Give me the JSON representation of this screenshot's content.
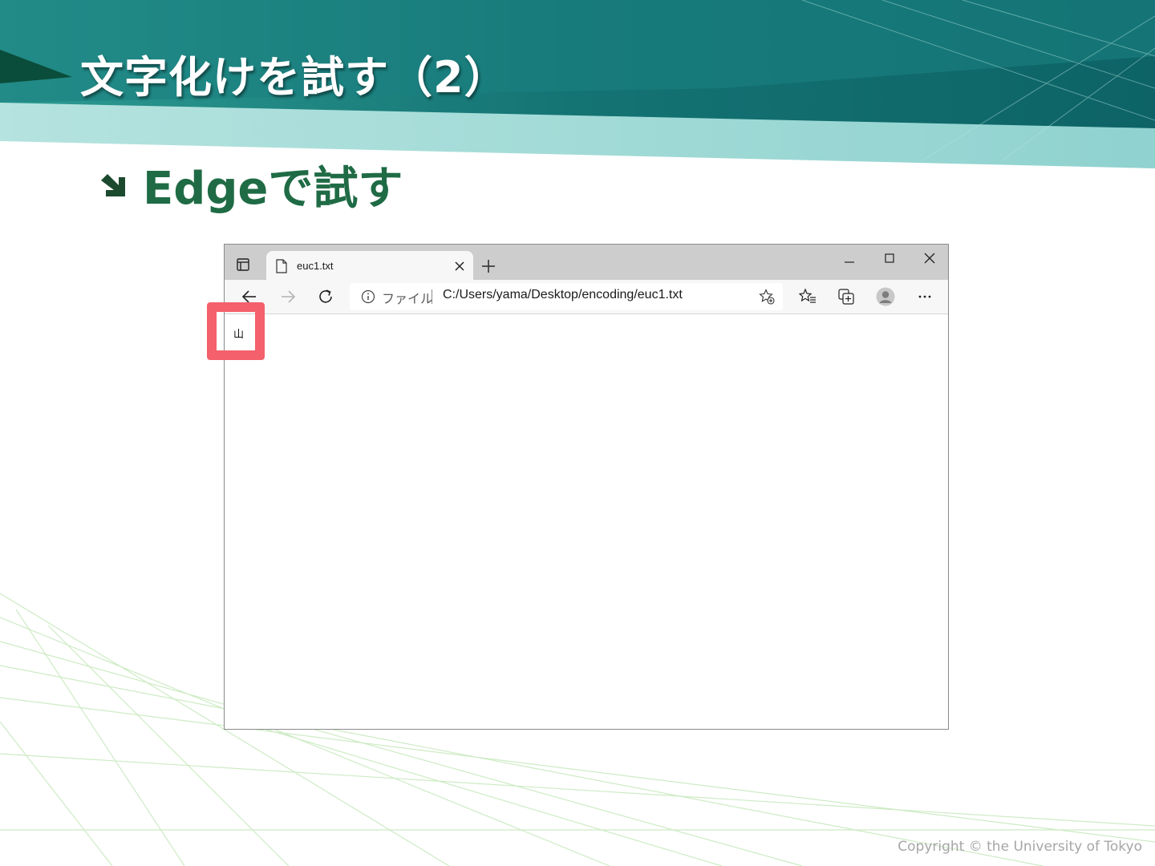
{
  "slide": {
    "title": "文字化けを試す（2）",
    "bullet": "Edgeで試す",
    "copyright": "Copyright © the University of Tokyo"
  },
  "browser": {
    "tab_title": "euc1.txt",
    "address_scheme": "ファイル",
    "address_url": "C:/Users/yama/Desktop/encoding/euc1.txt",
    "page_text": "山"
  },
  "colors": {
    "header_dark": "#0f6a6a",
    "header_light": "#9fd9d6",
    "bullet_green": "#1f6b45",
    "highlight": "#f4606b"
  }
}
